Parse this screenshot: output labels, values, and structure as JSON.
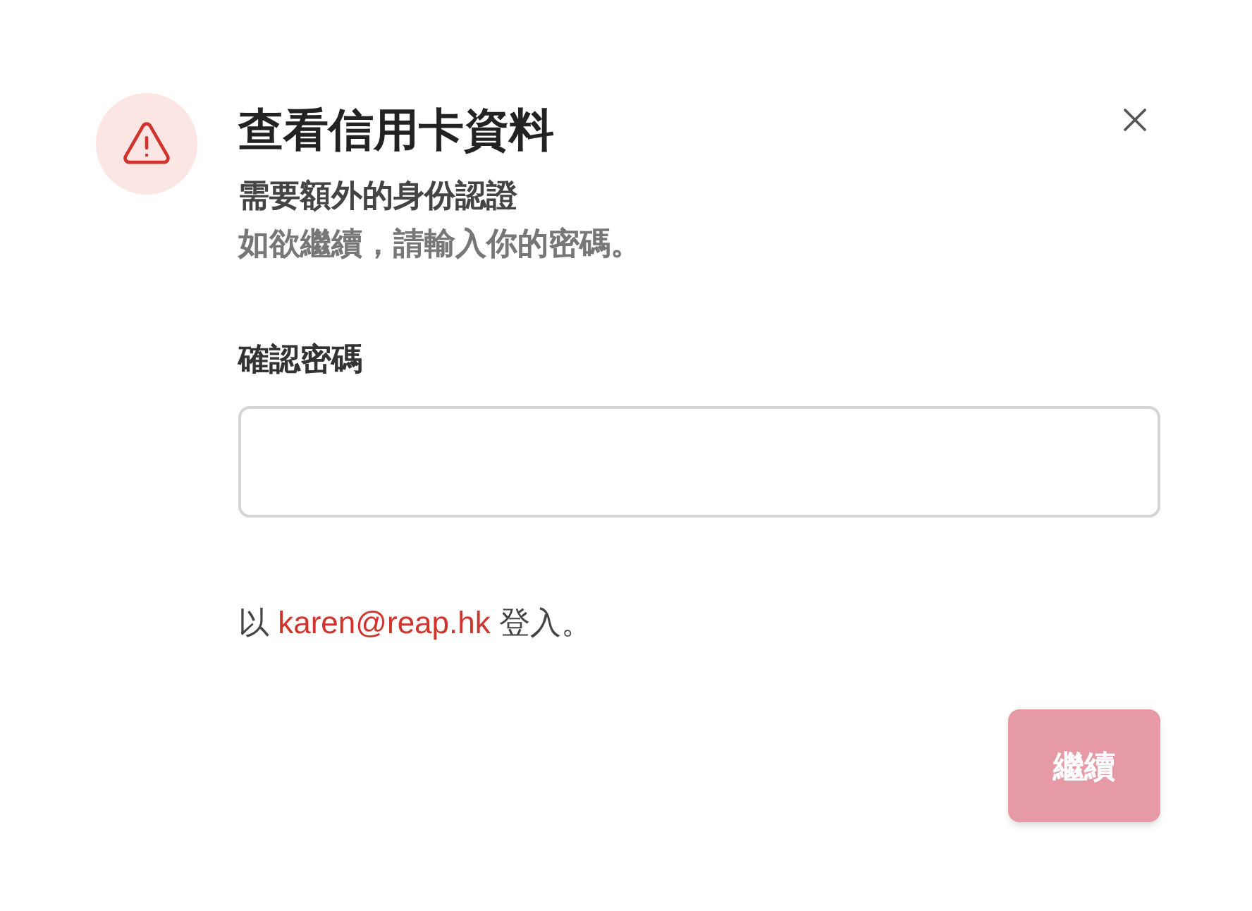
{
  "dialog": {
    "title": "查看信用卡資料",
    "subtitle": "需要額外的身份認證",
    "description": "如欲繼續，請輸入你的密碼。"
  },
  "password_field": {
    "label": "確認密碼"
  },
  "signed_in": {
    "prefix": "以",
    "email": "karen@reap.hk",
    "suffix": "登入。"
  },
  "continue_button": {
    "label": "繼續",
    "disabled": true
  }
}
